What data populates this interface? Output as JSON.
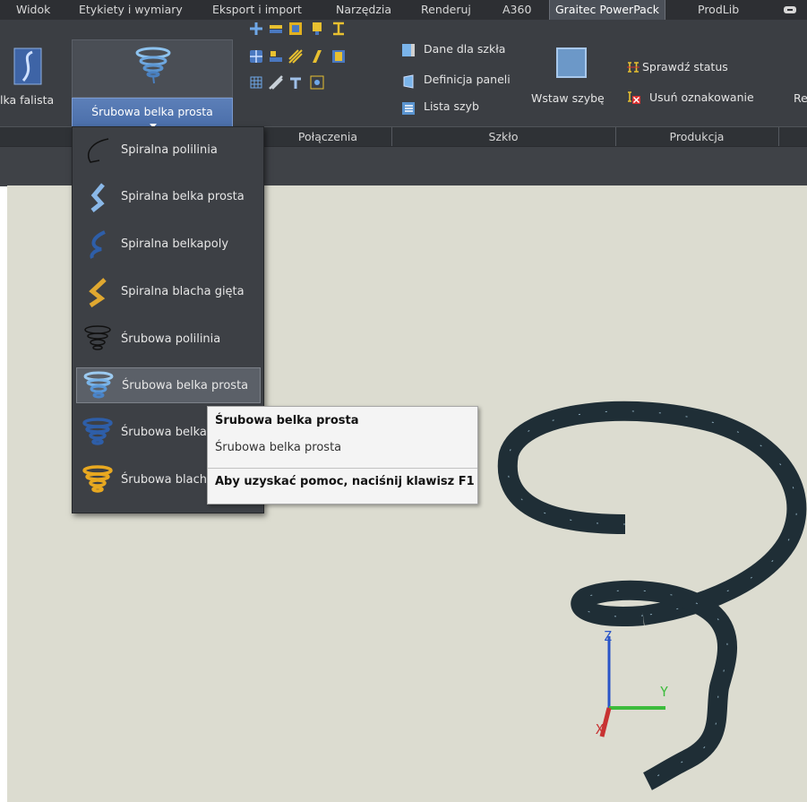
{
  "tabs": [
    "Widok",
    "Etykiety i wymiary",
    "Eksport i import",
    "Narzędzia",
    "Renderuj",
    "A360",
    "Graitec PowerPack",
    "ProdLib"
  ],
  "active_tab": "Graitec PowerPack",
  "ribbon": {
    "left_partial_label": "lka falista",
    "big_button_label": "Śrubowa belka prosta",
    "glass": {
      "dane": "Dane dla szkła",
      "definicja": "Definicja paneli",
      "lista": "Lista szyb",
      "wstaw": "Wstaw szybę"
    },
    "production": {
      "sprawdz": "Sprawdź status",
      "usun": "Usuń oznakowanie"
    },
    "right_partial_label": "Re",
    "panels": {
      "polaczenia": "Połączenia",
      "szklo": "Szkło",
      "produkcja": "Produkcja"
    }
  },
  "menu": {
    "items": [
      {
        "label": "Spiralna polilinia",
        "icon": "spiral-polyline-icon"
      },
      {
        "label": "Spiralna belka prosta",
        "icon": "spiral-straight-beam-icon"
      },
      {
        "label": "Spiralna belkapoly",
        "icon": "spiral-poly-beam-icon"
      },
      {
        "label": "Spiralna blacha gięta",
        "icon": "spiral-bent-plate-icon"
      },
      {
        "label": "Śrubowa polilinia",
        "icon": "helical-polyline-icon"
      },
      {
        "label": "Śrubowa belka prosta",
        "icon": "helical-straight-beam-icon"
      },
      {
        "label": "Śrubowa belka",
        "icon": "helical-beam-icon"
      },
      {
        "label": "Śrubowa blach",
        "icon": "helical-plate-icon"
      }
    ],
    "highlighted_index": 5
  },
  "tooltip": {
    "title": "Śrubowa belka prosta",
    "subtitle": "Śrubowa belka prosta",
    "help": "Aby uzyskać pomoc, naciśnij klawisz F1"
  },
  "ucs": {
    "x": "X",
    "y": "Y",
    "z": "Z"
  },
  "colors": {
    "ribbon_bg": "#3b3e43",
    "viewport_bg": "#dcdcd0",
    "helix_beam": "#1f2e36",
    "highlight_blue": "#466aa6"
  }
}
